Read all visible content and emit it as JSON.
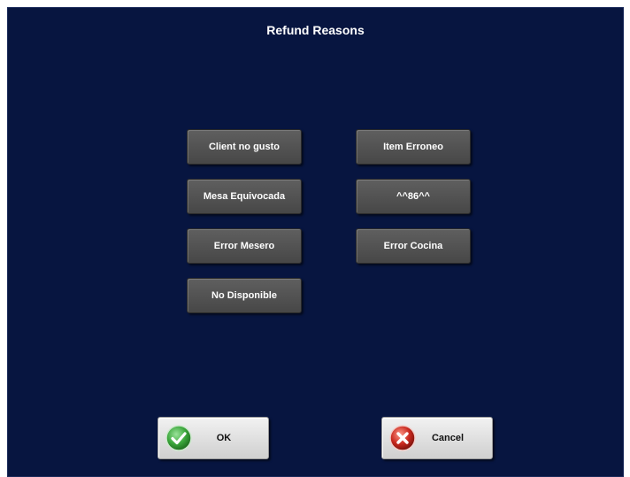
{
  "dialog": {
    "title": "Refund Reasons"
  },
  "reasons": [
    {
      "label": "Client no gusto"
    },
    {
      "label": "Item Erroneo"
    },
    {
      "label": "Mesa Equivocada"
    },
    {
      "label": "^^86^^"
    },
    {
      "label": "Error Mesero"
    },
    {
      "label": "Error Cocina"
    },
    {
      "label": "No Disponible"
    }
  ],
  "actions": {
    "ok_label": "OK",
    "cancel_label": "Cancel",
    "ok_icon": "check-circle-green-icon",
    "cancel_icon": "x-circle-red-icon"
  },
  "colors": {
    "background": "#071540",
    "button_gray": "#525252",
    "ok_green": "#3aa53a",
    "cancel_red": "#c8281e"
  }
}
